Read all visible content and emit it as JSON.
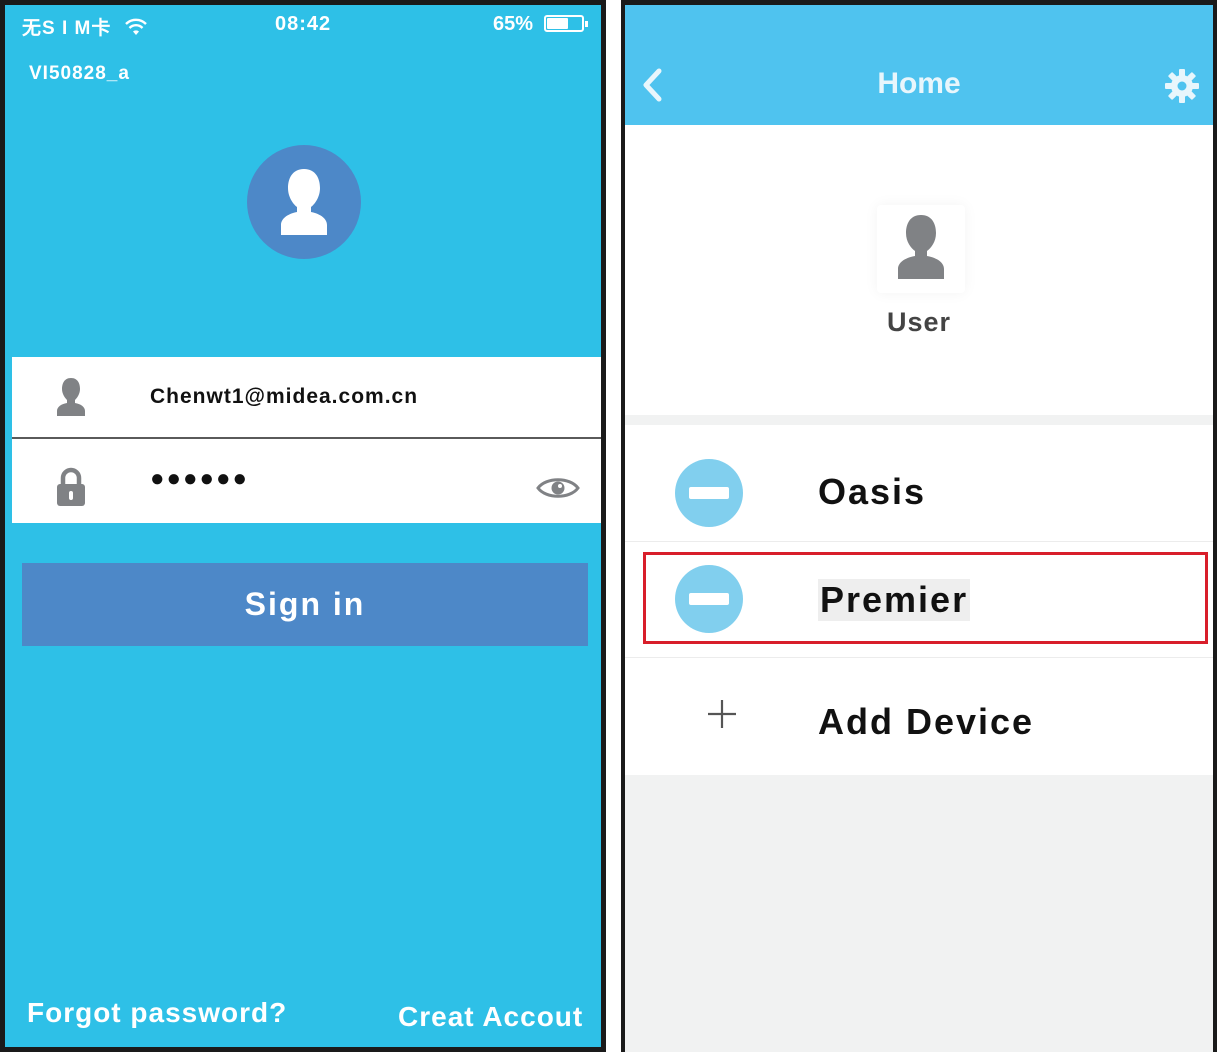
{
  "login_screen": {
    "status_bar": {
      "carrier": "无S I M卡",
      "time": "08:42",
      "battery": "65%",
      "battery_level": 0.65,
      "icons": [
        "wifi-icon",
        "battery-icon"
      ]
    },
    "network_name": "VI50828_a",
    "email": {
      "value": "Chenwt1@midea.com.cn",
      "icon": "user-icon"
    },
    "password": {
      "value": "●●●●●●",
      "icon": "lock-icon",
      "toggle_icon": "eye-icon"
    },
    "sign_in_label": "Sign in",
    "forgot_password_label": "Forgot password?",
    "create_account_label": "Creat Accout",
    "colors": {
      "background": "#2ec0e7",
      "accent": "#4d88c8"
    }
  },
  "home_screen": {
    "title": "Home",
    "icons": [
      "back-chevron-icon",
      "gear-icon"
    ],
    "user_name": "User",
    "devices": [
      {
        "label": "Oasis",
        "icon": "air-conditioner-icon"
      },
      {
        "label": "Premier",
        "icon": "air-conditioner-icon",
        "highlighted": true
      }
    ],
    "add_device_label": "Add Device",
    "colors": {
      "topbar": "#4fc3ef",
      "device_icon": "#81cfee",
      "highlight": "#d81e2a"
    }
  }
}
